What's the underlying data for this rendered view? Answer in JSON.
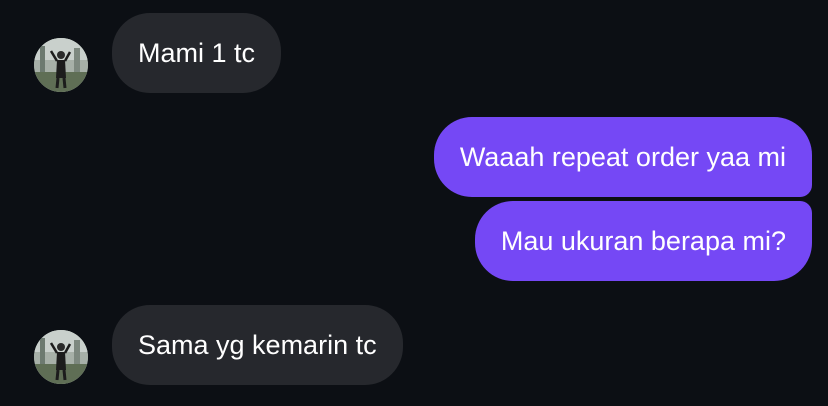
{
  "messages": [
    {
      "sender": "other",
      "text": "Mami 1 tc"
    },
    {
      "sender": "me",
      "text": "Waaah repeat order yaa mi"
    },
    {
      "sender": "me",
      "text": "Mau ukuran berapa mi?"
    },
    {
      "sender": "other",
      "text": "Sama yg kemarin tc"
    }
  ],
  "colors": {
    "background": "#0c0f14",
    "incoming_bubble": "#26282d",
    "outgoing_bubble": "#7548f5",
    "text": "#ffffff"
  }
}
